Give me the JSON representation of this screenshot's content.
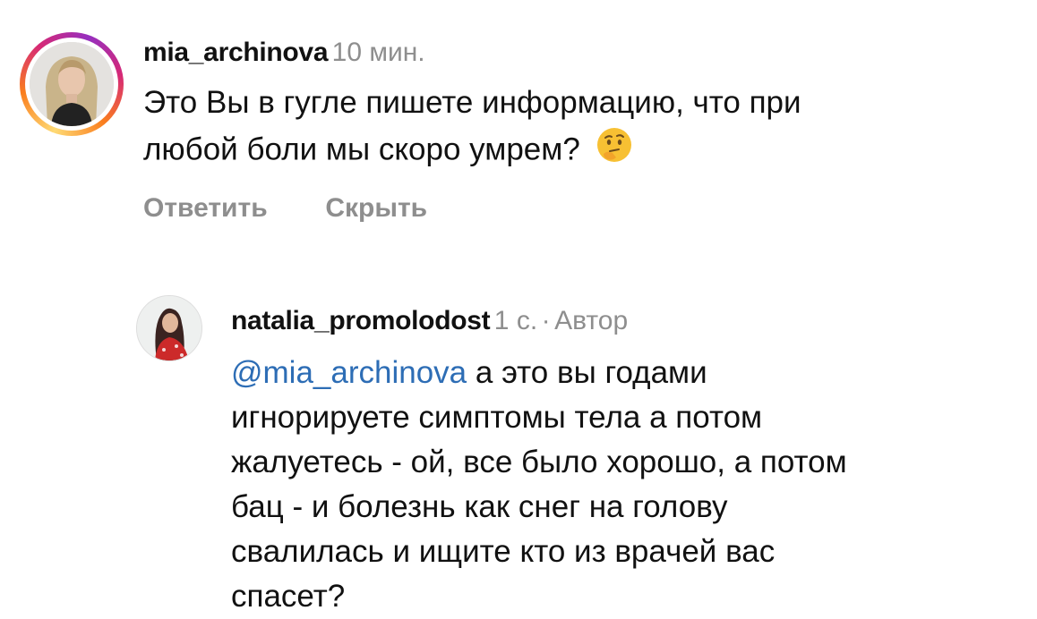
{
  "comments": [
    {
      "username": "mia_archinova",
      "time": "10 мин.",
      "text_line1": "Это Вы в гугле пишете информацию, что при",
      "text_line2": "любой боли мы скоро умрем?",
      "emoji": "thinking-face",
      "actions": {
        "reply": "Ответить",
        "hide": "Скрыть"
      }
    },
    {
      "username": "natalia_promolodost",
      "time": "1 с.",
      "separator": "·",
      "author_badge": "Автор",
      "mention": "@mia_archinova",
      "text_lines": [
        " а это вы годами",
        "игнорируете симптомы тела а потом",
        "жалуетесь - ой, все было хорошо, а потом",
        "бац - и болезнь как снег на голову",
        "свалилась и ищите кто из врачей вас",
        "спасет?"
      ]
    }
  ],
  "colors": {
    "text": "#111111",
    "secondary": "#8e8e8e",
    "mention": "#2d6db5"
  }
}
